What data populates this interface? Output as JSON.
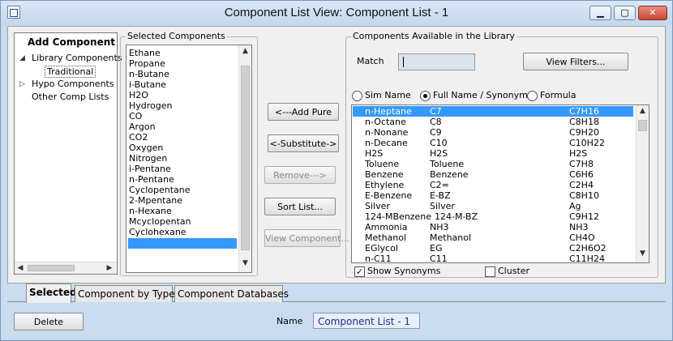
{
  "window": {
    "title": "Component List View: Component List - 1",
    "minimize_glyph": "▁",
    "maximize_glyph": "▢",
    "close_glyph": "✕"
  },
  "add_component": {
    "heading": "Add Component",
    "tree": [
      {
        "label": "Library Components",
        "expander": "◢"
      },
      {
        "label": "Traditional"
      },
      {
        "label": "Hypo Components",
        "expander": "▷"
      },
      {
        "label": "Other Comp Lists"
      }
    ]
  },
  "selected_components": {
    "title": "Selected Components",
    "items": [
      "Ethane",
      "Propane",
      "n-Butane",
      "i-Butane",
      "H2O",
      "Hydrogen",
      "CO",
      "Argon",
      "CO2",
      "Oxygen",
      "Nitrogen",
      "i-Pentane",
      "n-Pentane",
      "Cyclopentane",
      "2-Mpentane",
      "n-Hexane",
      "Mcyclopentan",
      "Cyclohexane"
    ]
  },
  "actions": {
    "add_pure": "<---Add Pure",
    "substitute": "<-Substitute->",
    "remove": "Remove--->",
    "sort_list": "Sort List...",
    "view_component": "View Component..."
  },
  "library": {
    "title": "Components Available in the Library",
    "match_label": "Match",
    "match_value": "",
    "view_filters": "View Filters...",
    "radio_options": [
      "Sim Name",
      "Full Name / Synonym",
      "Formula"
    ],
    "selected_radio": "Full Name / Synonym",
    "rows": [
      [
        "n-Heptane",
        "C7",
        "C7H16"
      ],
      [
        "n-Octane",
        "C8",
        "C8H18"
      ],
      [
        "n-Nonane",
        "C9",
        "C9H20"
      ],
      [
        "n-Decane",
        "C10",
        "C10H22"
      ],
      [
        "H2S",
        "H2S",
        "H2S"
      ],
      [
        "Toluene",
        "Toluene",
        "C7H8"
      ],
      [
        "Benzene",
        "Benzene",
        "C6H6"
      ],
      [
        "Ethylene",
        "C2=",
        "C2H4"
      ],
      [
        "E-Benzene",
        "E-BZ",
        "C8H10"
      ],
      [
        "Silver",
        "Silver",
        "Ag"
      ],
      [
        "124-MBenzene",
        "124-M-BZ",
        "C9H12"
      ],
      [
        "Ammonia",
        "NH3",
        "NH3"
      ],
      [
        "Methanol",
        "Methanol",
        "CH4O"
      ],
      [
        "EGlycol",
        "EG",
        "C2H6O2"
      ],
      [
        "n-C11",
        "C11",
        "C11H24"
      ]
    ],
    "show_synonyms_label": "Show Synonyms",
    "show_synonyms_checked": true,
    "cluster_label": "Cluster",
    "cluster_checked": false
  },
  "tabs": [
    "Selected",
    "Component by Type",
    "Component Databases"
  ],
  "active_tab": "Selected",
  "footer": {
    "delete": "Delete",
    "name_label": "Name",
    "name_value": "Component List - 1"
  },
  "colors": {
    "selection": "#3399ff",
    "window_frame": "#c9dcf0"
  }
}
